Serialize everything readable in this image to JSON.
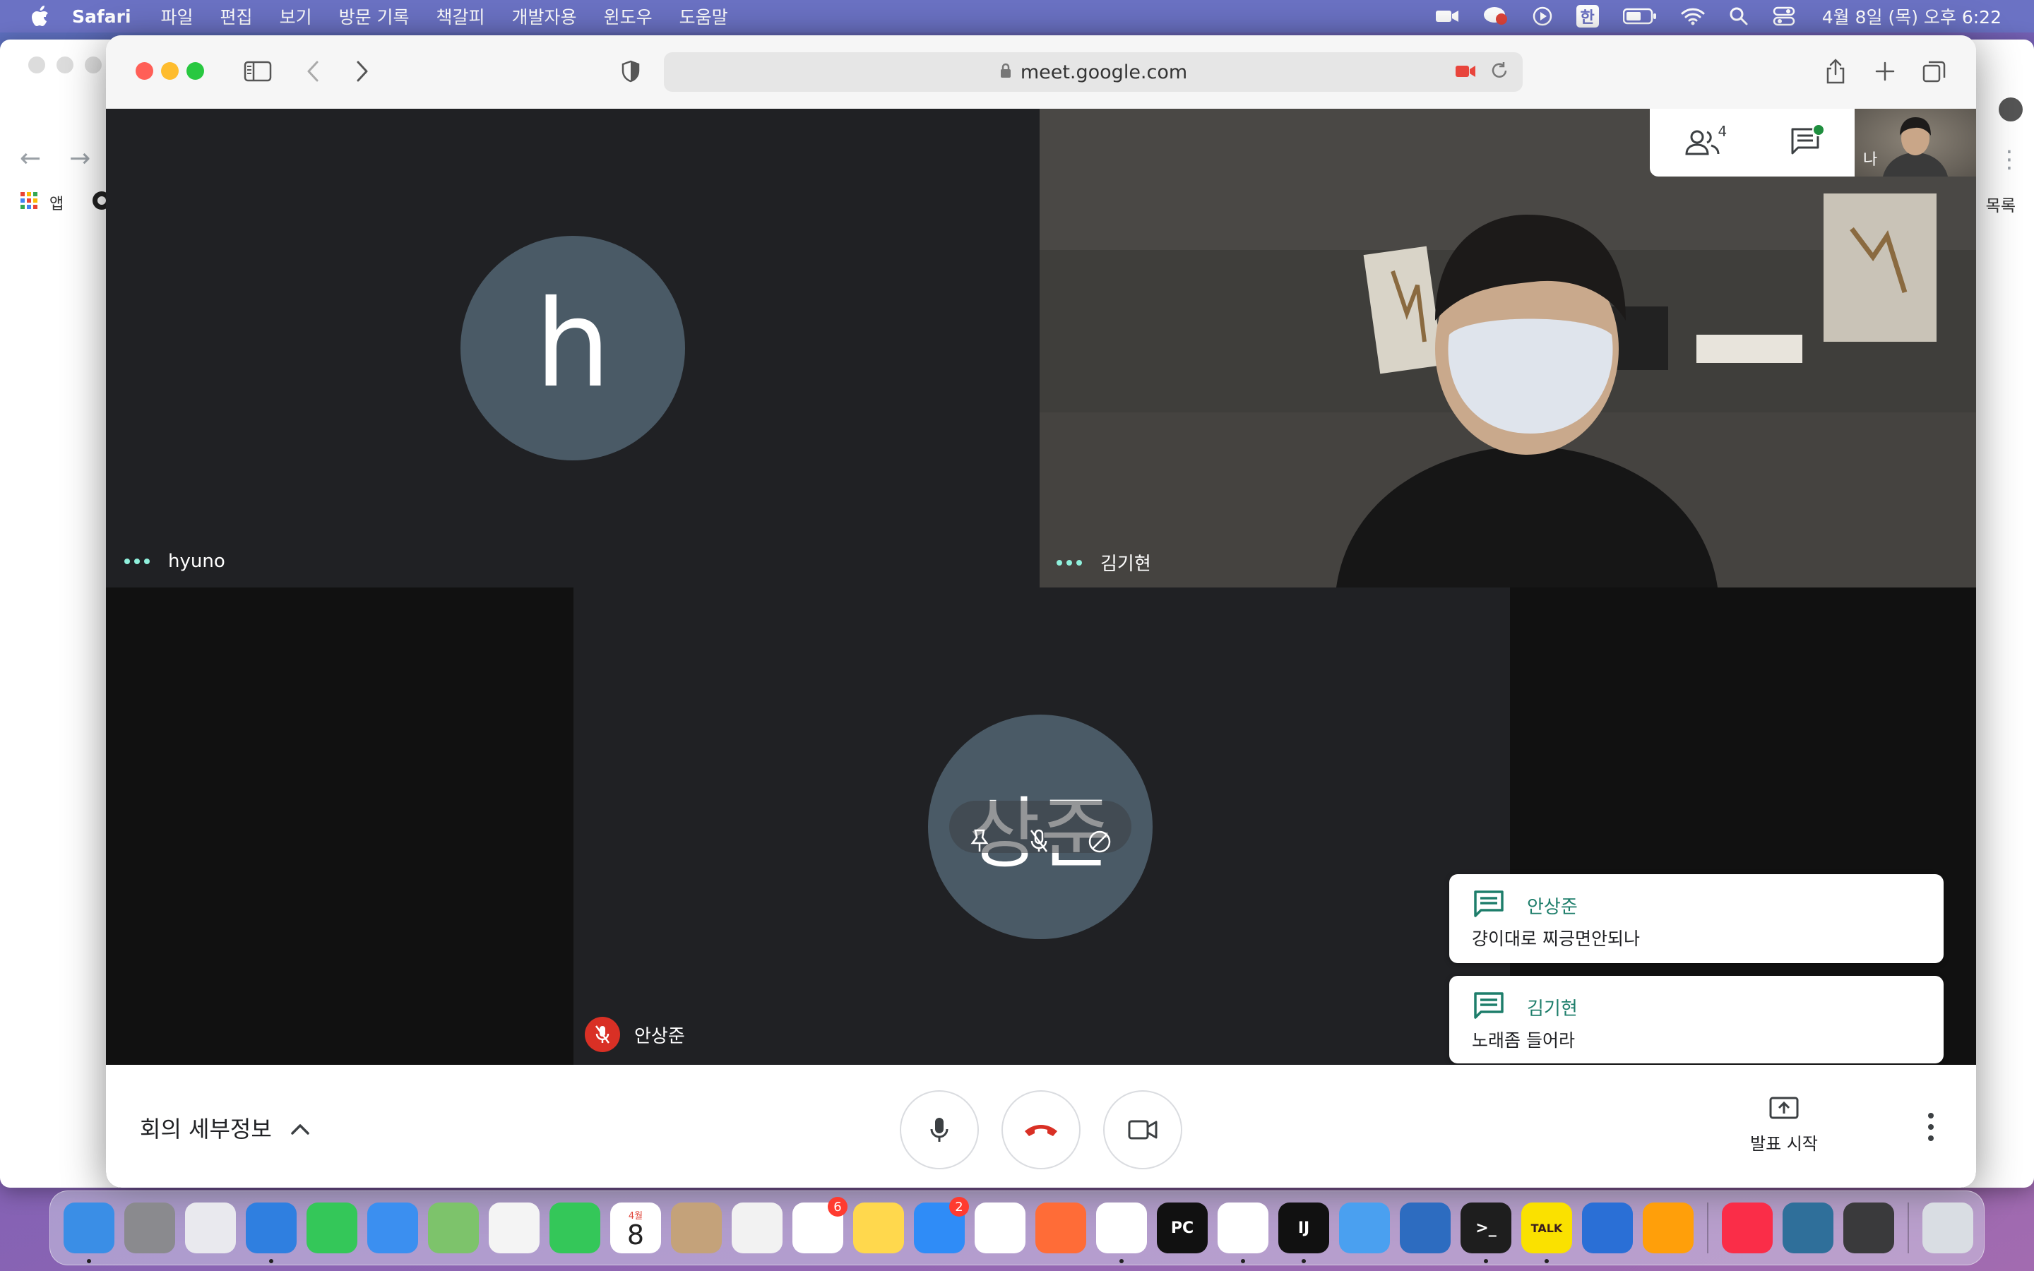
{
  "menubar": {
    "app_name": "Safari",
    "items": [
      "파일",
      "편집",
      "보기",
      "방문 기록",
      "책갈피",
      "개발자용",
      "윈도우",
      "도움말"
    ],
    "input_source": "한",
    "clock": "4월 8일 (목) 오후 6:22"
  },
  "background_window": {
    "bookmark_apps_label": "앱",
    "list_label": "목록"
  },
  "safari": {
    "url": "meet.google.com"
  },
  "meet": {
    "tiles": [
      {
        "name": "hyuno",
        "avatar_letter": "h"
      },
      {
        "name": "김기현"
      },
      {
        "name": "안상준",
        "avatar_letter": "상준",
        "muted": true
      }
    ],
    "participants_count": "4",
    "self_label": "나",
    "chat_notifications": [
      {
        "sender": "안상준",
        "message": "걍이대로 찌긍면안되나"
      },
      {
        "sender": "김기현",
        "message": "노래좀 들어라"
      }
    ],
    "meeting_details_label": "회의 세부정보",
    "present_label": "발표 시작",
    "accent_color": "#1e7e6b",
    "end_call_color": "#d93025"
  },
  "dock": {
    "apps": [
      {
        "name": "Finder",
        "color": "#3a8ee6"
      },
      {
        "name": "System Preferences",
        "color": "#8a8a8e"
      },
      {
        "name": "Launchpad",
        "color": "#e9e9ee"
      },
      {
        "name": "Safari",
        "color": "#2f7fe0"
      },
      {
        "name": "Messages",
        "color": "#34c759"
      },
      {
        "name": "Mail",
        "color": "#3b8ff0"
      },
      {
        "name": "Maps",
        "color": "#7dc36b"
      },
      {
        "name": "Photos",
        "color": "#f4f4f4"
      },
      {
        "name": "FaceTime",
        "color": "#34c759"
      },
      {
        "name": "Calendar",
        "color": "#ffffff",
        "month": "4월",
        "day": "8"
      },
      {
        "name": "Contacts",
        "color": "#c4a27a"
      },
      {
        "name": "TextEdit",
        "color": "#f2f2f2"
      },
      {
        "name": "Reminders",
        "color": "#ffffff",
        "badge": "6"
      },
      {
        "name": "Notes",
        "color": "#ffd84d"
      },
      {
        "name": "App Store",
        "color": "#2f8cf7",
        "badge": "2"
      },
      {
        "name": "Camo",
        "color": "#ffffff"
      },
      {
        "name": "Postman",
        "color": "#ff6c37"
      },
      {
        "name": "Chrome",
        "color": "#ffffff"
      },
      {
        "name": "PyCharm",
        "color": "#111111",
        "glyph": "PC"
      },
      {
        "name": "VS Code",
        "color": "#ffffff"
      },
      {
        "name": "IntelliJ IDEA",
        "color": "#111111",
        "glyph": "IJ"
      },
      {
        "name": "Xcode",
        "color": "#4aa0f0"
      },
      {
        "name": "Tiles",
        "color": "#2d6cc0"
      },
      {
        "name": "Terminal",
        "color": "#1e1e1e",
        "glyph": ">_"
      },
      {
        "name": "KakaoTalk",
        "color": "#fae100",
        "glyph": "TALK"
      },
      {
        "name": "Keynote",
        "color": "#2a6fd6"
      },
      {
        "name": "Pages",
        "color": "#ff9f0a"
      },
      {
        "name": "Music",
        "color": "#fa2d48"
      },
      {
        "name": "Mirror",
        "color": "#2f6f9a"
      },
      {
        "name": "QuickTime",
        "color": "#3a3a3c"
      },
      {
        "name": "Trash",
        "color": "#d9dde3"
      }
    ]
  }
}
